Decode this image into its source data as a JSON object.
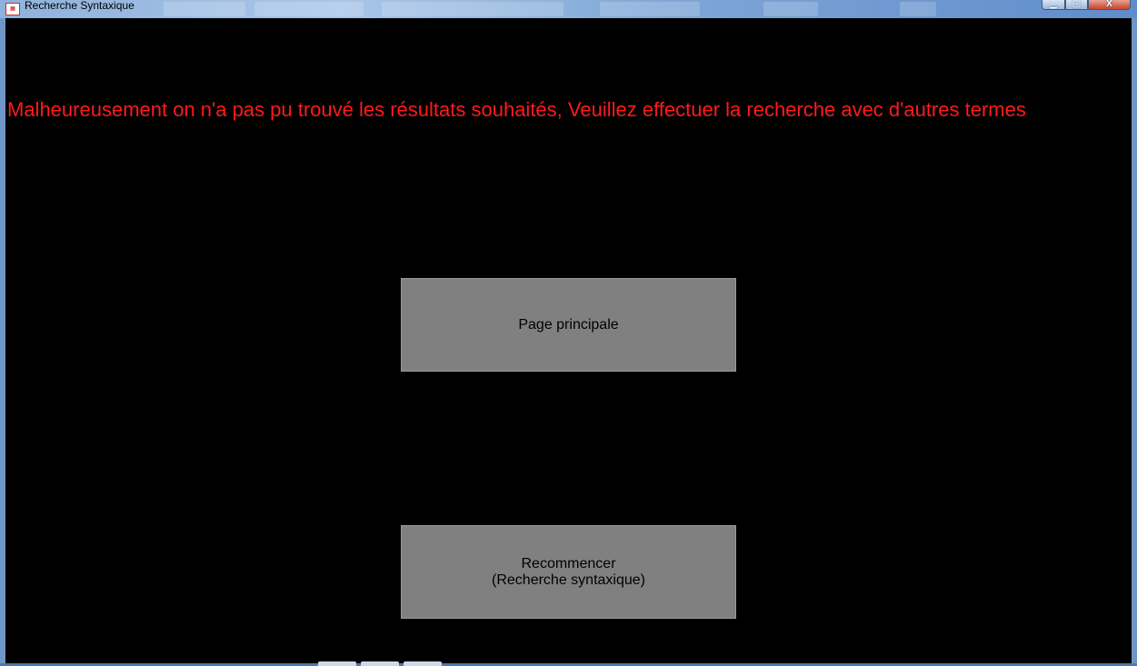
{
  "window": {
    "title": "Recherche Syntaxique",
    "icon": "app-icon",
    "controls": {
      "minimize_glyph": "▁",
      "maximize_glyph": "▢",
      "close_glyph": "X"
    }
  },
  "message": {
    "text": "Malheureusement on n'a pas pu trouvé les résultats souhaités, Veuillez effectuer la recherche avec d'autres termes",
    "color": "#ff1a1a"
  },
  "buttons": {
    "main_page": {
      "label": "Page principale"
    },
    "restart": {
      "line1": "Recommencer",
      "line2": "(Recherche syntaxique)"
    }
  },
  "colors": {
    "background": "#000000",
    "button_face": "#808080",
    "titlebar": "#7ea5d6"
  }
}
